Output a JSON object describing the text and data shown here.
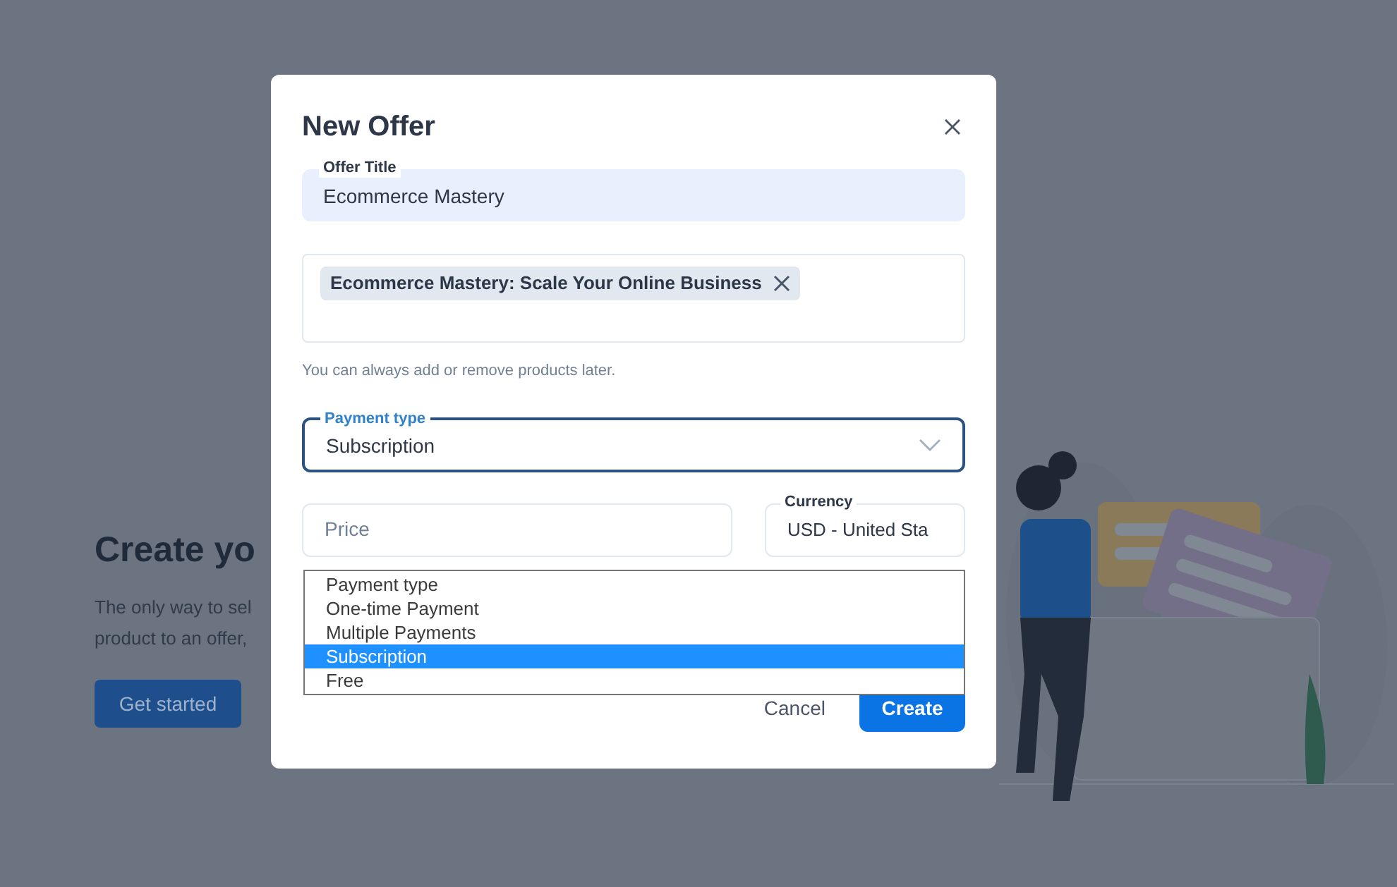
{
  "page": {
    "heading": "Create yo",
    "description_lines": [
      "The only way to sel",
      "product to an offer,"
    ],
    "button": "Get started"
  },
  "dialog": {
    "title": "New Offer",
    "offer_title": {
      "label": "Offer Title",
      "value": "Ecommerce Mastery"
    },
    "products": {
      "chips": [
        "Ecommerce Mastery: Scale Your Online Business"
      ],
      "helper": "You can always add or remove products later."
    },
    "payment_type": {
      "label": "Payment type",
      "value": "Subscription",
      "expanded": true,
      "options": [
        {
          "label": "Payment type",
          "selected": false
        },
        {
          "label": "One-time Payment",
          "selected": false
        },
        {
          "label": "Multiple Payments",
          "selected": false
        },
        {
          "label": "Subscription",
          "selected": true
        },
        {
          "label": "Free",
          "selected": false
        }
      ]
    },
    "price": {
      "placeholder": "Price"
    },
    "currency": {
      "label": "Currency",
      "value": "USD - United Sta"
    },
    "buttons": {
      "cancel": "Cancel",
      "create": "Create"
    }
  }
}
